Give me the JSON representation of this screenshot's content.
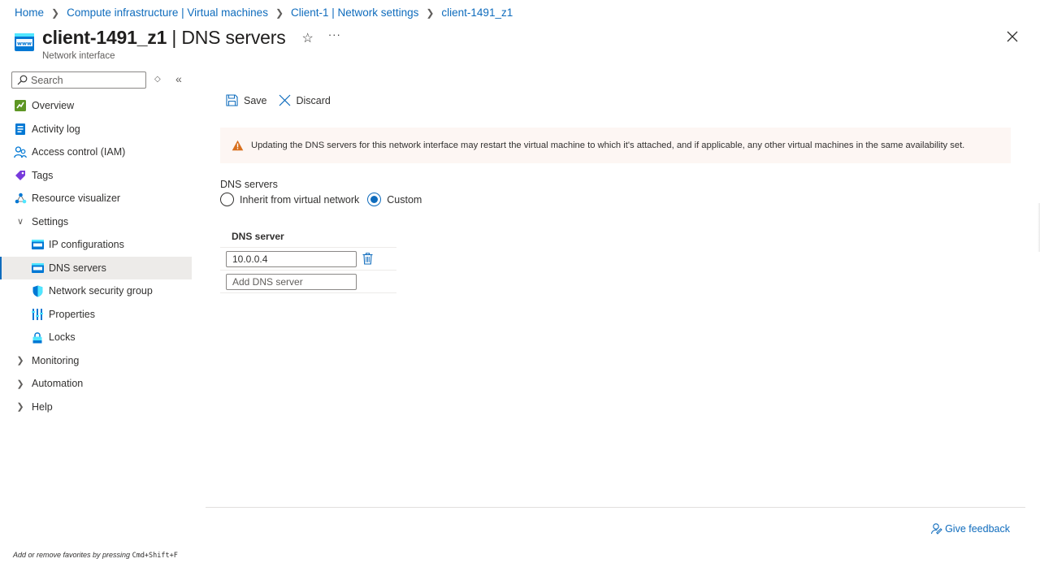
{
  "breadcrumb": [
    {
      "label": "Home"
    },
    {
      "label": "Compute infrastructure | Virtual machines"
    },
    {
      "label": "Client-1 | Network settings"
    },
    {
      "label": "client-1491_z1"
    }
  ],
  "header": {
    "resource_name": "client-1491_z1",
    "title_suffix": " | DNS servers",
    "subtitle": "Network interface",
    "more_label": "···",
    "star_icon": "star-icon"
  },
  "search": {
    "placeholder": "Search"
  },
  "nav": {
    "items": [
      {
        "label": "Overview",
        "icon": "overview-icon"
      },
      {
        "label": "Activity log",
        "icon": "activity-log-icon"
      },
      {
        "label": "Access control (IAM)",
        "icon": "iam-icon"
      },
      {
        "label": "Tags",
        "icon": "tag-icon"
      },
      {
        "label": "Resource visualizer",
        "icon": "visualizer-icon"
      },
      {
        "label": "Settings",
        "expanded": true
      },
      {
        "label": "IP configurations",
        "icon": "network-interface-icon"
      },
      {
        "label": "DNS servers",
        "icon": "network-interface-icon",
        "selected": true
      },
      {
        "label": "Network security group",
        "icon": "shield-icon"
      },
      {
        "label": "Properties",
        "icon": "properties-icon"
      },
      {
        "label": "Locks",
        "icon": "lock-icon"
      },
      {
        "label": "Monitoring",
        "expanded": false
      },
      {
        "label": "Automation",
        "expanded": false
      },
      {
        "label": "Help",
        "expanded": false
      }
    ]
  },
  "toolbar": {
    "save_label": "Save",
    "discard_label": "Discard"
  },
  "warning": {
    "text": "Updating the DNS servers for this network interface may restart the virtual machine to which it's attached, and if applicable, any other virtual machines in the same availability set."
  },
  "dns": {
    "section_label": "DNS servers",
    "options": [
      {
        "label": "Inherit from virtual network",
        "checked": false
      },
      {
        "label": "Custom",
        "checked": true
      }
    ],
    "column_header": "DNS server",
    "servers": [
      "10.0.0.4"
    ],
    "add_placeholder": "Add DNS server"
  },
  "footer": {
    "feedback_label": "Give feedback",
    "hint_prefix": "Add or remove favorites by pressing ",
    "hint_keys": "Cmd+Shift+F"
  },
  "colors": {
    "accent": "#0f6cbd",
    "warning": "#d86f1d",
    "selected_bg": "#edebe9"
  }
}
